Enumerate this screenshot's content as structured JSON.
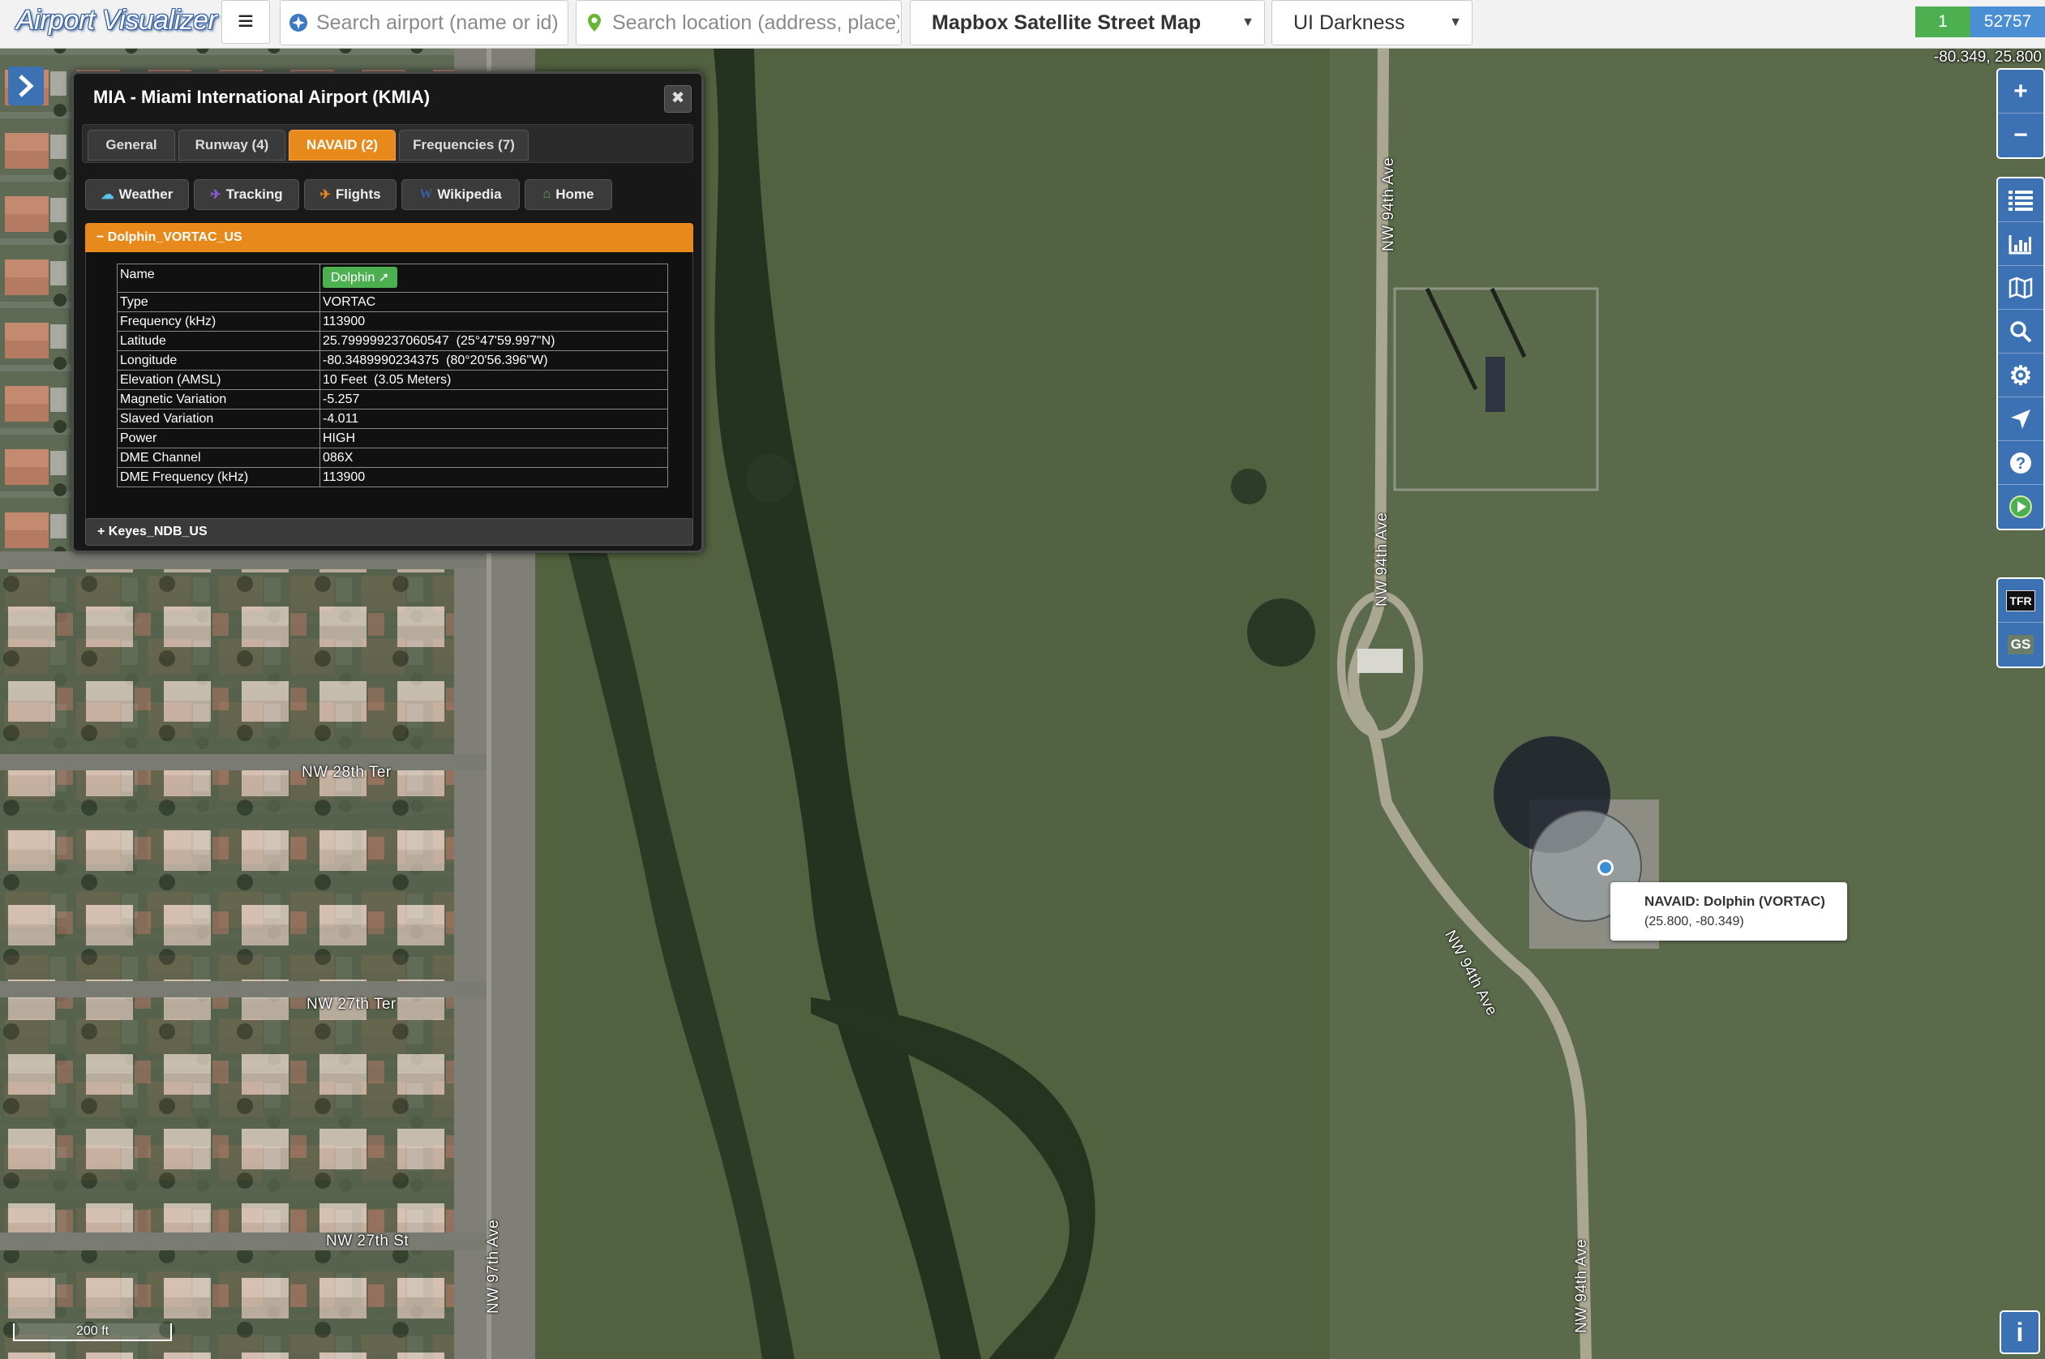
{
  "app": {
    "logo": "Airport Visualizer"
  },
  "topbar": {
    "airport_search_placeholder": "Search airport (name or id)",
    "location_search_placeholder": "Search location (address, place)",
    "map_style": "Mapbox Satellite Street Map",
    "ui_theme": "UI Darkness",
    "counter_left": "1",
    "counter_right": "52757"
  },
  "map": {
    "coord_readout": "-80.349, 25.800",
    "scale_label": "200 ft",
    "streets": [
      "NW 94th Ave",
      "NW 94th Ave",
      "NW 94th Ave",
      "NW 94th Ave",
      "NW 28th Ter",
      "NW 27th Ter",
      "NW 27th St",
      "NW 97th Ave"
    ],
    "tooltip": {
      "title": "NAVAID: Dolphin (VORTAC)",
      "coords": "(25.800, -80.349)"
    }
  },
  "panel": {
    "title": "MIA - Miami International Airport (KMIA)",
    "close_icon": "✖",
    "tabs": [
      {
        "label": "General"
      },
      {
        "label": "Runway (4)"
      },
      {
        "label": "NAVAID (2)"
      },
      {
        "label": "Frequencies (7)"
      }
    ],
    "actions": [
      {
        "label": "Weather",
        "icon": "cloud-icon"
      },
      {
        "label": "Tracking",
        "icon": "plane-icon"
      },
      {
        "label": "Flights",
        "icon": "plane-icon"
      },
      {
        "label": "Wikipedia",
        "icon": "wikipedia-icon"
      },
      {
        "label": "Home",
        "icon": "home-icon"
      }
    ],
    "section": {
      "title": "Dolphin_VORTAC_US",
      "toggle": "−",
      "rows": [
        {
          "key": "Name",
          "value": "Dolphin"
        },
        {
          "key": "Type",
          "value": "VORTAC"
        },
        {
          "key": "Frequency (kHz)",
          "value": "113900"
        },
        {
          "key": "Latitude",
          "value": "25.799999237060547  (25°47'59.997\"N)"
        },
        {
          "key": "Longitude",
          "value": "-80.3489990234375  (80°20'56.396\"W)"
        },
        {
          "key": "Elevation (AMSL)",
          "value": "10 Feet  (3.05 Meters)"
        },
        {
          "key": "Magnetic Variation",
          "value": "-5.257"
        },
        {
          "key": "Slaved Variation",
          "value": "-4.011"
        },
        {
          "key": "Power",
          "value": "HIGH"
        },
        {
          "key": "DME Channel",
          "value": "086X"
        },
        {
          "key": "DME Frequency (kHz)",
          "value": "113900"
        }
      ]
    },
    "section2": {
      "title": "Keyes_NDB_US",
      "toggle": "+"
    }
  },
  "toolbar": {
    "zoom_in": "+",
    "zoom_out": "−",
    "tfr_label": "TFR",
    "gs_label": "GS",
    "info_label": "i"
  },
  "colors": {
    "accent_orange": "#e8891c",
    "toolbar_blue": "#3c71b3",
    "green": "#4caf50"
  }
}
